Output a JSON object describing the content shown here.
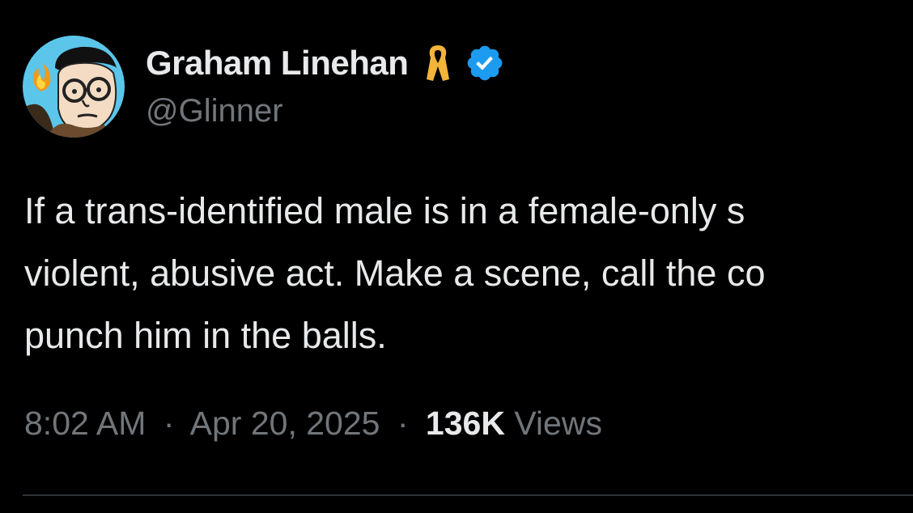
{
  "author": {
    "display_name": "Graham Linehan",
    "handle": "@Glinner",
    "avatar_icon": "cartoon-avatar",
    "badges": [
      "yellow-ribbon-icon",
      "verified-badge-icon"
    ],
    "colors": {
      "ribbon": "#f2b43a",
      "verified": "#1d9bf0"
    }
  },
  "tweet": {
    "lines": [
      "If a trans-identified male is in a female-only s",
      "violent, abusive act. Make a scene, call the co",
      "punch him in the balls."
    ]
  },
  "meta": {
    "time": "8:02 AM",
    "date": "Apr 20, 2025",
    "separator": "·",
    "views_count": "136K",
    "views_label": "Views"
  },
  "colors": {
    "background": "#000000",
    "primary_text": "#e7e9ea",
    "secondary_text": "#71767b",
    "divider": "#2f3336"
  }
}
